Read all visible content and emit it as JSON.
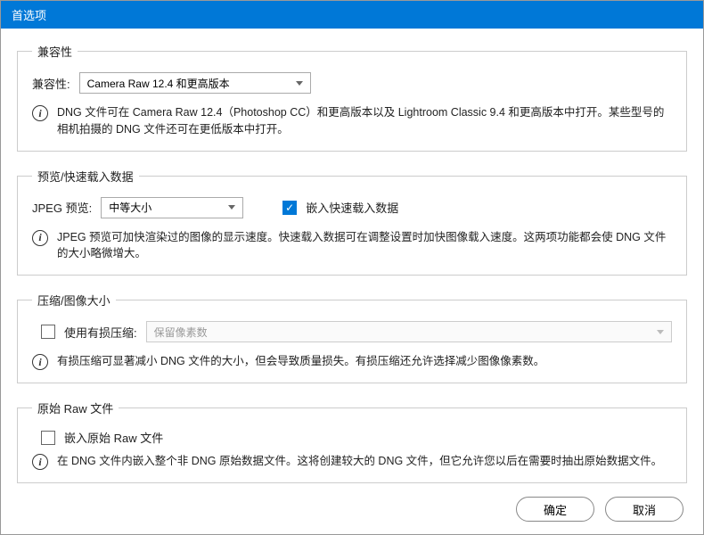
{
  "titlebar": {
    "title": "首选项"
  },
  "compat": {
    "legend": "兼容性",
    "label": "兼容性:",
    "value": "Camera Raw 12.4 和更高版本",
    "info": "DNG 文件可在 Camera Raw 12.4（Photoshop CC）和更高版本以及 Lightroom Classic 9.4 和更高版本中打开。某些型号的相机拍摄的 DNG 文件还可在更低版本中打开。"
  },
  "preview": {
    "legend": "预览/快速载入数据",
    "jpeg_label": "JPEG 预览:",
    "jpeg_value": "中等大小",
    "embed_label": "嵌入快速载入数据",
    "info": "JPEG 预览可加快渲染过的图像的显示速度。快速载入数据可在调整设置时加快图像载入速度。这两项功能都会使 DNG 文件的大小略微增大。"
  },
  "compress": {
    "legend": "压缩/图像大小",
    "lossy_label": "使用有损压缩:",
    "lossy_value": "保留像素数",
    "info": "有损压缩可显著减小 DNG 文件的大小，但会导致质量损失。有损压缩还允许选择减少图像像素数。"
  },
  "raw": {
    "legend": "原始 Raw 文件",
    "embed_label": "嵌入原始 Raw 文件",
    "info": "在 DNG 文件内嵌入整个非 DNG 原始数据文件。这将创建较大的 DNG 文件，但它允许您以后在需要时抽出原始数据文件。"
  },
  "buttons": {
    "ok": "确定",
    "cancel": "取消"
  }
}
